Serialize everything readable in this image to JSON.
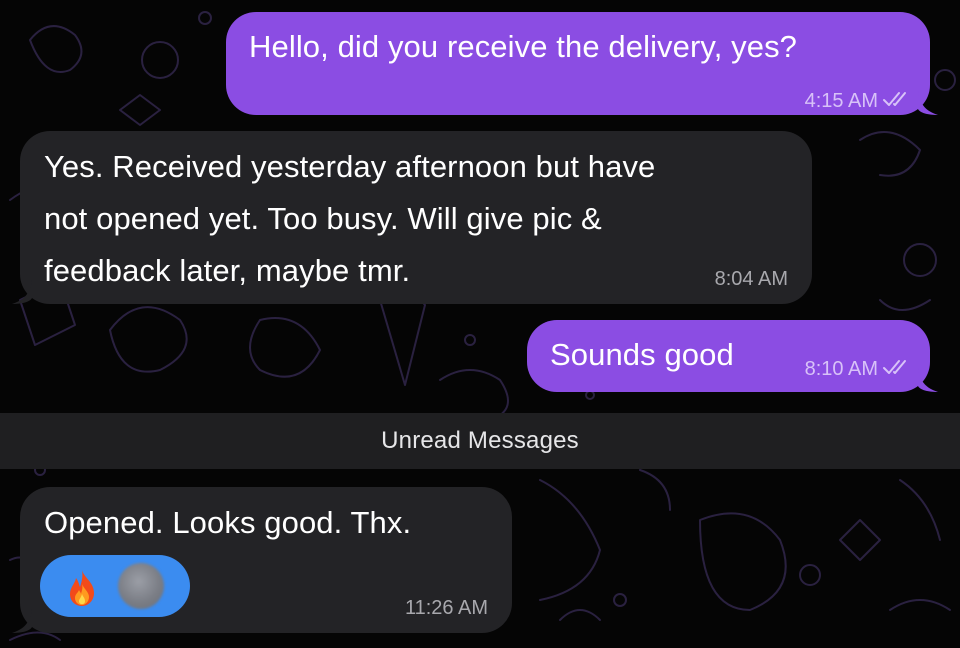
{
  "chat": {
    "messages": [
      {
        "direction": "outgoing",
        "text": "Hello, did you receive the delivery, yes?",
        "time": "4:15 AM",
        "status": "read"
      },
      {
        "direction": "incoming",
        "lines": [
          "Yes. Received yesterday afternoon but have",
          "not opened yet. Too busy. Will give pic &",
          "feedback later, maybe tmr."
        ],
        "time": "8:04 AM"
      },
      {
        "direction": "outgoing",
        "text": "Sounds good",
        "time": "8:10 AM",
        "status": "read"
      },
      {
        "direction": "incoming",
        "text": "Opened. Looks good. Thx.",
        "time": "11:26 AM",
        "reaction": {
          "icon": "fire-icon",
          "reactor": "blurred-avatar"
        }
      }
    ],
    "unread_divider": "Unread Messages"
  },
  "colors": {
    "background": "#050505",
    "outgoing_bubble": "#8b4de3",
    "incoming_bubble": "#232326",
    "reaction_pill": "#3b8cf0",
    "unread_bar": "#1f1f21"
  }
}
